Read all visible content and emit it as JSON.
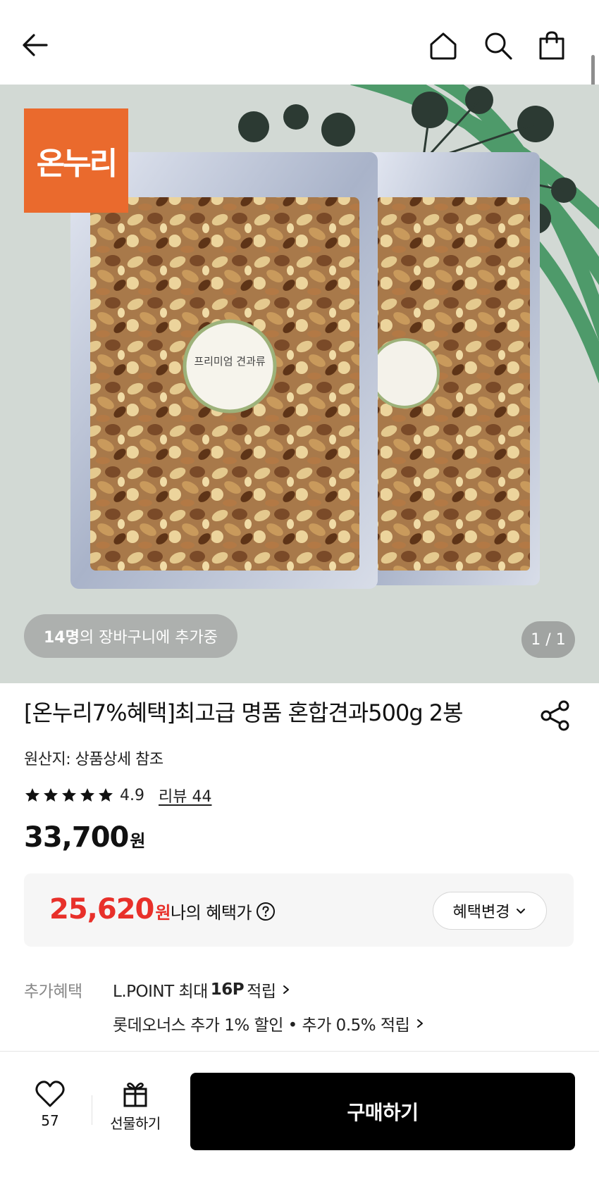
{
  "header": {
    "back_icon": "arrow-left-icon",
    "home_icon": "home-icon",
    "search_icon": "search-icon",
    "bag_icon": "shopping-bag-icon"
  },
  "hero": {
    "brand_logo_text": "온누리",
    "brand_logo_color": "#ea6a2d",
    "package_label": "프리미엄 견과류",
    "cart_count": "14명",
    "cart_text": "의 장바구니에 추가중",
    "pager": "1 / 1"
  },
  "product": {
    "title": "[온누리7%혜택]최고급 명품 혼합견과500g 2봉",
    "origin": "원산지: 상품상세 참조",
    "rating": "4.9",
    "rating_stars": 5,
    "review_link": "리뷰 44",
    "price": "33,700",
    "price_unit": "원"
  },
  "benefit": {
    "price": "25,620",
    "price_unit": "원",
    "label": "나의 혜택가",
    "change_button": "혜택변경",
    "accent_color": "#e8302a"
  },
  "extra_benefits": {
    "label": "추가혜택",
    "line1_prefix": "L.POINT 최대",
    "line1_bold": "16P",
    "line1_suffix": "적립",
    "line2": "롯데오너스 추가 1% 할인 • 추가 0.5% 적립"
  },
  "bottom_bar": {
    "like_count": "57",
    "gift_label": "선물하기",
    "buy_label": "구매하기"
  }
}
